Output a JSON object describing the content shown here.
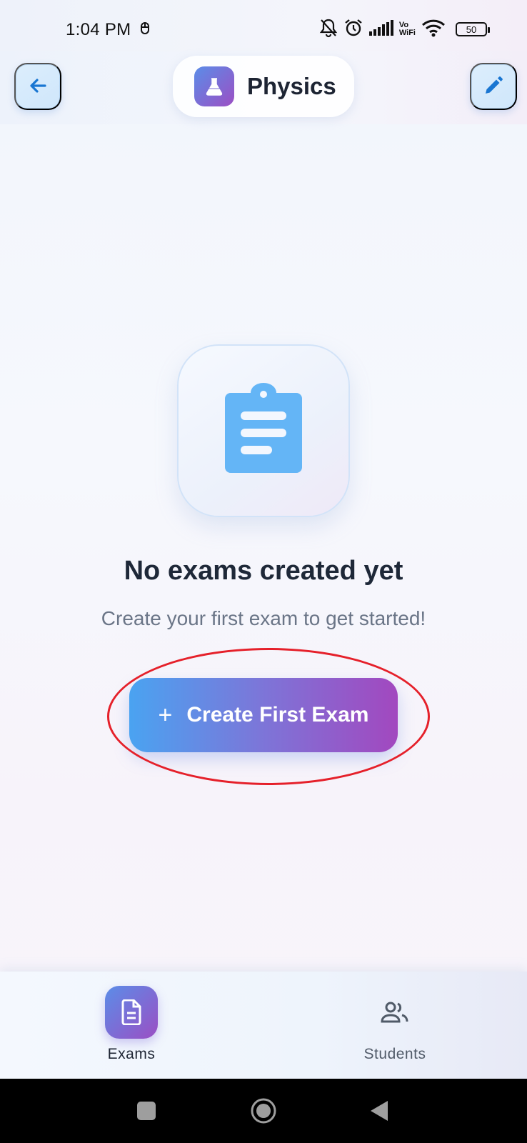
{
  "status_bar": {
    "time": "1:04 PM",
    "battery": "50",
    "vo_top": "Vo",
    "vo_bottom": "WiFi",
    "icons": [
      "notification-icon",
      "bell-off-icon",
      "alarm-icon",
      "signal-icon",
      "vowifi-icon",
      "wifi-icon",
      "battery-icon"
    ]
  },
  "header": {
    "title": "Physics",
    "icons": [
      "back-arrow-icon",
      "flask-icon",
      "pencil-icon"
    ]
  },
  "empty_state": {
    "icon": "clipboard-icon",
    "title": "No exams created yet",
    "subtitle": "Create your first exam to get started!",
    "button_label": "Create First Exam",
    "button_plus": "+"
  },
  "bottom_nav": {
    "items": [
      {
        "label": "Exams",
        "icon": "document-icon",
        "active": true
      },
      {
        "label": "Students",
        "icon": "people-icon",
        "active": false
      }
    ]
  },
  "system_nav": {
    "icons": [
      "recents-square-icon",
      "home-circle-icon",
      "back-triangle-icon"
    ]
  },
  "colors": {
    "accent_start": "#4aa3f1",
    "accent_mid": "#7d75d8",
    "accent_end": "#a248bf",
    "title_text": "#1e2838",
    "subtitle_text": "#6a7587",
    "highlight_ring": "#e5202a",
    "clipboard": "#64b5f6"
  }
}
